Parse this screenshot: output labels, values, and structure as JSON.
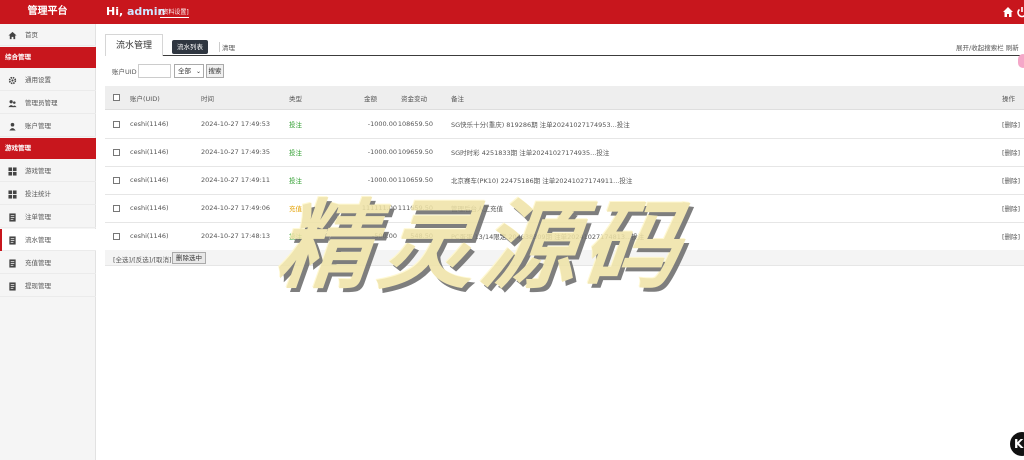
{
  "header": {
    "brand": "管理平台",
    "greeting": "Hi,",
    "username": "admin",
    "profile_link": "[资料设置]"
  },
  "sidebar": {
    "items": [
      {
        "label": "首页",
        "icon": "home-icon"
      },
      {
        "group": "综合管理"
      },
      {
        "label": "通用设置",
        "icon": "gear-icon"
      },
      {
        "label": "管理员管理",
        "icon": "users-icon"
      },
      {
        "label": "账户管理",
        "icon": "user-icon"
      },
      {
        "group": "游戏管理"
      },
      {
        "label": "游戏管理",
        "icon": "grid-icon"
      },
      {
        "label": "投注统计",
        "icon": "grid-icon"
      },
      {
        "label": "注单管理",
        "icon": "doc-icon"
      },
      {
        "label": "流水管理",
        "icon": "doc-icon",
        "active": true
      },
      {
        "label": "充值管理",
        "icon": "doc-icon"
      },
      {
        "label": "提现管理",
        "icon": "doc-icon"
      }
    ]
  },
  "page": {
    "title": "流水管理",
    "tab_list": "流水列表",
    "tab_clear": "清理",
    "right_links": "展开/收起搜索栏  刷新"
  },
  "search": {
    "label": "账户UID",
    "input_value": "",
    "select_value": "全部",
    "button": "搜索"
  },
  "table": {
    "columns": [
      "账户(UID)",
      "时间",
      "类型",
      "金额",
      "资金变动",
      "备注",
      "操作"
    ],
    "rows": [
      {
        "uid": "ceshi(1146)",
        "time": "2024-10-27 17:49:53",
        "type": "投注",
        "amount": "-1000.00",
        "balance": "108659.50",
        "note": "SG快乐十分(重庆) 819286期 注单20241027174953...投注",
        "op": "[删除]"
      },
      {
        "uid": "ceshi(1146)",
        "time": "2024-10-27 17:49:35",
        "type": "投注",
        "amount": "-1000.00",
        "balance": "109659.50",
        "note": "SG时时彩 4251833期 注单20241027174935...投注",
        "op": "[删除]"
      },
      {
        "uid": "ceshi(1146)",
        "time": "2024-10-27 17:49:11",
        "type": "投注",
        "amount": "-1000.00",
        "balance": "110659.50",
        "note": "北京赛车(PK10) 22475186期 注单20241027174911...投注",
        "op": "[删除]"
      },
      {
        "uid": "ceshi(1146)",
        "time": "2024-10-27 17:49:06",
        "type": "充值",
        "amount": "111111.00",
        "balance": "111659.50",
        "note": "管理后台人工充值",
        "op": "[删除]"
      },
      {
        "uid": "ceshi(1146)",
        "time": "2024-10-27 17:48:13",
        "type": "投注",
        "amount": "-500.00",
        "balance": "548.50",
        "note": "PC蛋蛋 13/14限定 204638309期 注单20241027174813...投注",
        "op": "[删除]"
      }
    ]
  },
  "footer": {
    "links": "[全选]/[反选]/[取消]",
    "delete_button": "删除选中"
  },
  "watermark": "精灵源码",
  "corner_badge": "K",
  "colors": {
    "brand_red": "#c8161d",
    "bet_green": "#2e9d2e",
    "recharge_orange": "#e3a000",
    "tab_dark": "#2f3640"
  }
}
